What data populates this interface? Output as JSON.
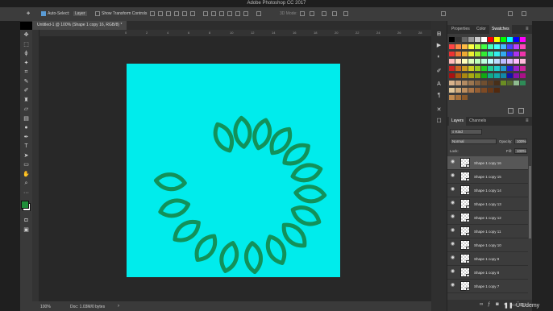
{
  "app": {
    "title": "Adobe Photoshop CC 2017"
  },
  "options_bar": {
    "auto_select_label": "Auto-Select:",
    "auto_select_value": "Layer",
    "transform_label": "Show Transform Controls",
    "mode_3d": "3D Mode:"
  },
  "document": {
    "tab_label": "Untitled-1 @ 100% (Shape 1 copy 16, RGB/8) *",
    "ruler_ticks": [
      "0",
      "2",
      "4",
      "6",
      "8",
      "10",
      "12",
      "14",
      "16",
      "18",
      "20",
      "22",
      "24",
      "26",
      "28"
    ]
  },
  "status": {
    "zoom": "100%",
    "doc_info": "Doc: 1.03M/0 bytes"
  },
  "panels": {
    "top_tabs": [
      "Properties",
      "Color",
      "Swatches"
    ],
    "active_top_tab": "Swatches",
    "layers_tabs": [
      "Layers",
      "Channels"
    ],
    "filter_label": "Kind",
    "blend_mode": "Normal",
    "opacity_label": "Opacity:",
    "opacity_value": "100%",
    "lock_label": "Lock:",
    "fill_label": "Fill:",
    "fill_value": "100%"
  },
  "layers": [
    {
      "name": "Shape 1 copy 16",
      "selected": true
    },
    {
      "name": "Shape 1 copy 15",
      "selected": false
    },
    {
      "name": "Shape 1 copy 14",
      "selected": false
    },
    {
      "name": "Shape 1 copy 13",
      "selected": false
    },
    {
      "name": "Shape 1 copy 12",
      "selected": false
    },
    {
      "name": "Shape 1 copy 11",
      "selected": false
    },
    {
      "name": "Shape 1 copy 10",
      "selected": false
    },
    {
      "name": "Shape 1 copy 9",
      "selected": false
    },
    {
      "name": "Shape 1 copy 8",
      "selected": false
    },
    {
      "name": "Shape 1 copy 7",
      "selected": false
    }
  ],
  "colors": {
    "canvas_bg": "#00ecec",
    "shape_stroke": "#12915a",
    "foreground": "#1f8f3a",
    "background": "#ffffff"
  },
  "watermark": "Udemy",
  "icons": [
    "move-icon",
    "marquee-icon",
    "lasso-icon",
    "magic-wand-icon",
    "crop-icon",
    "eyedropper-icon",
    "brush-icon",
    "stamp-icon",
    "eraser-icon",
    "gradient-icon",
    "dodge-icon",
    "pen-icon",
    "type-icon",
    "path-select-icon",
    "shape-icon",
    "hand-icon",
    "zoom-icon",
    "more-icon",
    "eye-icon"
  ]
}
